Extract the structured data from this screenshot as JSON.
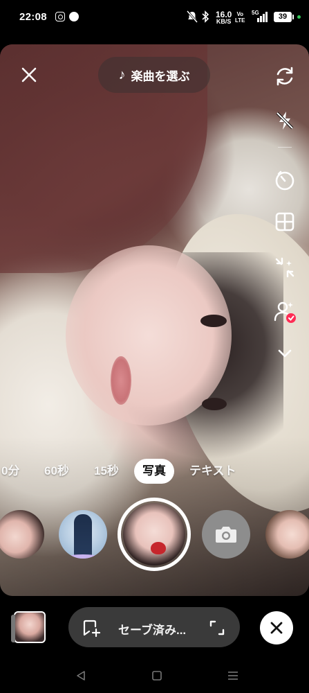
{
  "status_bar": {
    "time": "22:08",
    "apps": [
      "instagram-icon",
      "line-icon"
    ],
    "network_speed_value": "16.0",
    "network_speed_unit": "KB/S",
    "volte_top": "Vo",
    "volte_bottom": "LTE",
    "signal": "5G",
    "battery": "39"
  },
  "top": {
    "close_icon": "close-icon",
    "sound_label": "楽曲を選ぶ",
    "sound_icon": "music-note-icon"
  },
  "right_rail": [
    "flip-camera-icon",
    "flash-off-icon",
    "timer-icon",
    "layout-icon",
    "retouch-icon",
    "collab-icon",
    "chevron-down-icon"
  ],
  "modes": [
    "0分",
    "60秒",
    "15秒",
    "写真",
    "テキスト"
  ],
  "active_mode": "写真",
  "effects": [
    "face-effect",
    "figure-effect",
    "selected-effect",
    "photo-camera-icon",
    "face-effect"
  ],
  "bottom_bar": {
    "saved_label": "セーブ済み...",
    "add_icon": "add-to-album-icon",
    "expand_icon": "expand-icon",
    "discard_icon": "close-icon"
  },
  "nav": [
    "back-icon",
    "home-icon",
    "recents-icon"
  ],
  "colors": {
    "accent_check": "#fe2c55",
    "pill_bg": "#3a3a3a",
    "status_dot": "#34c759"
  }
}
